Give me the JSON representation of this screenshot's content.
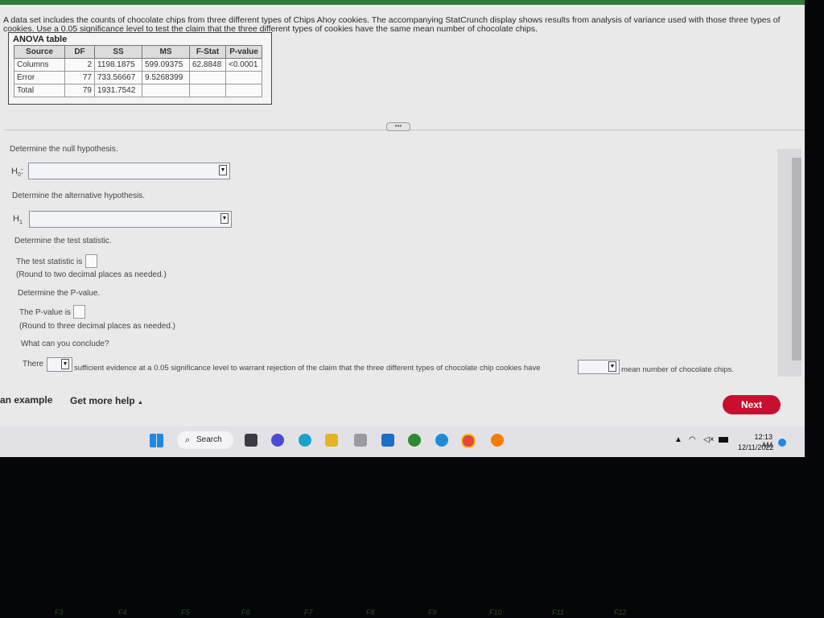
{
  "problem": {
    "text_line1": "A data set includes the counts of chocolate chips from three different types of Chips Ahoy cookies. The accompanying StatCrunch display shows results from analysis of variance used with those three types of",
    "text_line2": "cookies. Use a 0.05 significance level to test the claim that the three different types of cookies have the same mean number of chocolate chips."
  },
  "anova": {
    "title": "ANOVA table",
    "headers": [
      "Source",
      "DF",
      "SS",
      "MS",
      "F-Stat",
      "P-value"
    ],
    "rows": [
      [
        "Columns",
        "2",
        "1198.1875",
        "599.09375",
        "62.8848",
        "<0.0001"
      ],
      [
        "Error",
        "77",
        "733.56667",
        "9.5268399",
        "",
        ""
      ],
      [
        "Total",
        "79",
        "1931.7542",
        "",
        "",
        ""
      ]
    ]
  },
  "expand_pill": "•••",
  "questions": {
    "null_prompt": "Determine the null hypothesis.",
    "h0_label": "H",
    "h0_sub": "0",
    "alt_prompt": "Determine the alternative hypothesis.",
    "h1_label": "H",
    "h1_sub": "1",
    "stat_prompt": "Determine the test statistic.",
    "stat_text": "The test statistic is",
    "stat_round": "(Round to two decimal places as needed.)",
    "p_prompt": "Determine the P-value.",
    "p_text": "The P-value is",
    "p_round": "(Round to three decimal places as needed.)",
    "conclude_prompt": "What can you conclude?",
    "conclude_there": "There",
    "conclude_mid": "sufficient evidence at a 0.05 significance level to warrant rejection of the claim that the three different types of chocolate chip cookies have",
    "conclude_end": "mean number of chocolate chips."
  },
  "footer": {
    "example": "an example",
    "help": "Get more help",
    "help_arrow": "▲",
    "next": "Next"
  },
  "taskbar": {
    "search": "Search",
    "time": "12:13 AM",
    "date": "12/11/2022"
  },
  "keyboard": {
    "keys": [
      "F3",
      "F4",
      "F5",
      "F6",
      "F7",
      "F8",
      "F9",
      "F10",
      "F11",
      "F12"
    ]
  }
}
